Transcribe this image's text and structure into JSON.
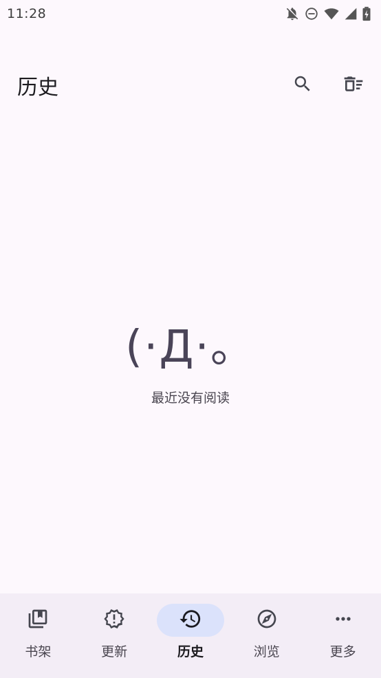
{
  "status_bar": {
    "time": "11:28",
    "icons": [
      "bell-off-icon",
      "do-not-disturb-icon",
      "wifi-icon",
      "signal-icon",
      "battery-charging-icon"
    ]
  },
  "header": {
    "title": "历史",
    "actions": [
      {
        "icon": "search-icon"
      },
      {
        "icon": "delete-sweep-icon"
      }
    ]
  },
  "empty_state": {
    "kaomoji": "(·Д·。",
    "message": "最近没有阅读"
  },
  "bottom_nav": {
    "items": [
      {
        "label": "书架",
        "icon": "library-icon",
        "active": false
      },
      {
        "label": "更新",
        "icon": "updates-icon",
        "active": false
      },
      {
        "label": "历史",
        "icon": "history-icon",
        "active": true
      },
      {
        "label": "浏览",
        "icon": "compass-icon",
        "active": false
      },
      {
        "label": "更多",
        "icon": "more-horiz-icon",
        "active": false
      }
    ]
  },
  "colors": {
    "background": "#fdf8fd",
    "nav_background": "#f3edf6",
    "active_indicator": "#dbe2fb",
    "icon": "#45464f",
    "text": "#1c1b1f"
  }
}
